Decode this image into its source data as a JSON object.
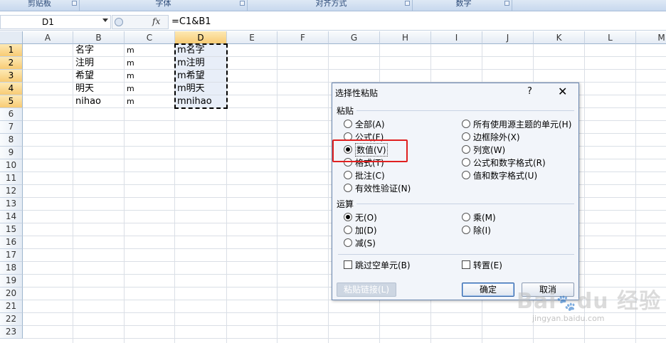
{
  "ribbon": {
    "groups": [
      {
        "label": "剪贴板"
      },
      {
        "label": "字体"
      },
      {
        "label": "对齐方式"
      },
      {
        "label": "数字"
      },
      {
        "label": ""
      }
    ]
  },
  "formula_bar": {
    "name_box": "D1",
    "fx_label": "fx",
    "formula": "=C1&B1"
  },
  "sheet": {
    "columns": [
      "A",
      "B",
      "C",
      "D",
      "E",
      "F",
      "G",
      "H",
      "I",
      "J",
      "K",
      "L",
      "M"
    ],
    "rows": [
      "1",
      "2",
      "3",
      "4",
      "5",
      "6",
      "7",
      "8",
      "9",
      "10",
      "11",
      "12",
      "13",
      "14",
      "15",
      "16",
      "17",
      "18",
      "19",
      "20",
      "21",
      "22",
      "23"
    ],
    "col_b": [
      "名字",
      "注明",
      "希望",
      "明天",
      "nihao"
    ],
    "col_c": [
      "m",
      "m",
      "m",
      "m",
      "m"
    ],
    "col_d": [
      "m名字",
      "m注明",
      "m希望",
      "m明天",
      "mnihao"
    ]
  },
  "dialog": {
    "title": "选择性粘贴",
    "help": "?",
    "close": "✕",
    "paste_section": "粘贴",
    "paste_options": [
      {
        "label": "全部(A)",
        "selected": false
      },
      {
        "label": "公式(F)",
        "selected": false
      },
      {
        "label": "数值(V)",
        "selected": true
      },
      {
        "label": "格式(T)",
        "selected": false
      },
      {
        "label": "批注(C)",
        "selected": false
      },
      {
        "label": "有效性验证(N)",
        "selected": false
      },
      {
        "label": "所有使用源主题的单元(H)",
        "selected": false
      },
      {
        "label": "边框除外(X)",
        "selected": false
      },
      {
        "label": "列宽(W)",
        "selected": false
      },
      {
        "label": "公式和数字格式(R)",
        "selected": false
      },
      {
        "label": "值和数字格式(U)",
        "selected": false
      }
    ],
    "operation_section": "运算",
    "operation_options": [
      {
        "label": "无(O)",
        "selected": true
      },
      {
        "label": "加(D)",
        "selected": false
      },
      {
        "label": "减(S)",
        "selected": false
      },
      {
        "label": "乘(M)",
        "selected": false
      },
      {
        "label": "除(I)",
        "selected": false
      }
    ],
    "skip_blanks": {
      "label": "跳过空单元(B)",
      "checked": false
    },
    "transpose": {
      "label": "转置(E)",
      "checked": false
    },
    "paste_link_button": "粘贴链接(L)",
    "ok_button": "确定",
    "cancel_button": "取消"
  },
  "watermark": {
    "brand": "Bai",
    "brand2": "du 经验",
    "url": "jingyan.baidu.com"
  },
  "colors": {
    "highlight_box": "#e02020",
    "selected_header": "#f8cb74"
  }
}
